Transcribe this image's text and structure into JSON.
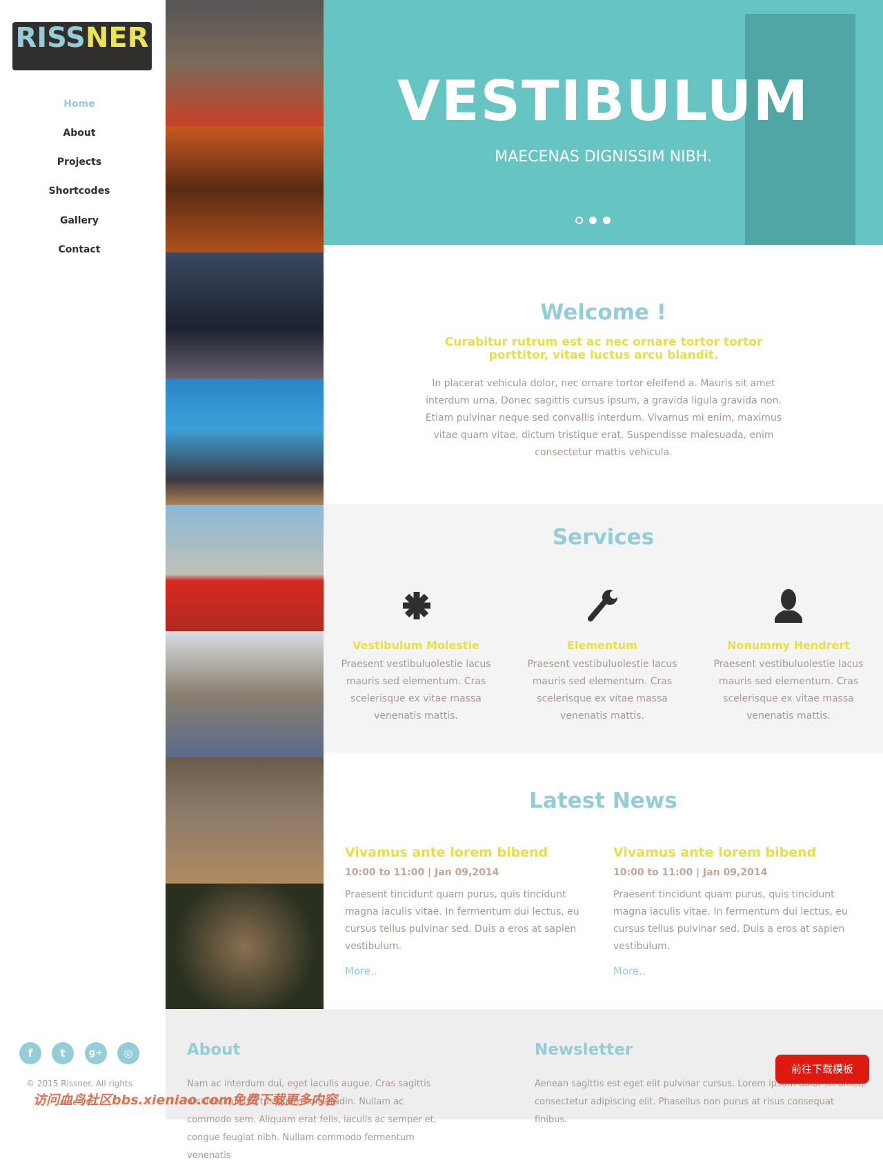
{
  "brand": {
    "part1": "RISS",
    "part2": "NER"
  },
  "nav": [
    {
      "label": "Home",
      "active": true
    },
    {
      "label": "About"
    },
    {
      "label": "Projects"
    },
    {
      "label": "Shortcodes"
    },
    {
      "label": "Gallery"
    },
    {
      "label": "Contact"
    }
  ],
  "hero": {
    "title": "VESTIBULUM",
    "subtitle": "MAECENAS DIGNISSIM NIBH.",
    "slides": 3,
    "active_slide": 1
  },
  "welcome": {
    "title": "Welcome !",
    "subtitle": "Curabitur rutrum est ac nec ornare tortor tortor porttitor, vitae luctus arcu blandit.",
    "text": "In placerat vehicula dolor, nec ornare tortor eleifend a. Mauris sit amet interdum urna. Donec sagittis cursus ipsum, a gravida ligula gravida non. Etiam pulvinar neque sed convallis interdum. Vivamus mi enim, maximus vitae quam vitae, dictum tristique erat. Suspendisse malesuada, enim consectetur mattis vehicula."
  },
  "services": {
    "title": "Services",
    "items": [
      {
        "icon": "asterisk-icon",
        "title": "Vestibulum Molestie",
        "text": "Praesent vestibuluolestie lacus mauris sed elementum. Cras scelerisque ex vitae massa venenatis mattis."
      },
      {
        "icon": "wrench-icon",
        "title": "Elementum",
        "text": "Praesent vestibuluolestie lacus mauris sed elementum. Cras scelerisque ex vitae massa venenatis mattis."
      },
      {
        "icon": "user-icon",
        "title": "Nonummy Hendrert",
        "text": "Praesent vestibuluolestie lacus mauris sed elementum. Cras scelerisque ex vitae massa venenatis mattis."
      }
    ]
  },
  "news": {
    "title": "Latest News",
    "items": [
      {
        "title": "Vivamus ante lorem bibend",
        "meta": "10:00 to 11:00 | Jan 09,2014",
        "text": "Praesent tincidunt quam purus, quis tincidunt magna iaculis vitae. In fermentum dui lectus, eu cursus tellus pulvinar sed. Duis a eros at sapien vestibulum.",
        "more": "More.."
      },
      {
        "title": "Vivamus ante lorem bibend",
        "meta": "10:00 to 11:00 | Jan 09,2014",
        "text": "Praesent tincidunt quam purus, quis tincidunt magna iaculis vitae. In fermentum dui lectus, eu cursus tellus pulvinar sed. Duis a eros at sapien vestibulum.",
        "more": "More.."
      }
    ]
  },
  "footer": {
    "about_title": "About",
    "about_text": "Nam ac interdum dui, eget iaculis augue. Cras sagittis orci leo, quis luctus quam sollicitudin. Nullam ac commodo sem. Aliquam erat felis, iaculis ac semper et, congue feugiat nibh. Nullam commodo fermentum venenatis",
    "newsletter_title": "Newsletter",
    "newsletter_text": "Aenean sagittis est eget elit pulvinar cursus. Lorem ipsum dolor sit amet, consectetur adipiscing elit. Phasellus non purus at risus consequat finibus.",
    "copyright": "© 2015 Rissner. All rights reserved.",
    "social": [
      "f",
      "t",
      "g+",
      "ig"
    ]
  },
  "download_button": "前往下载模板",
  "watermark": "访问血鸟社区bbs.xieniao.com免费下载更多内容",
  "colors": {
    "accent": "#94cdd7",
    "yellow": "#e6df47",
    "dark": "#312f2d",
    "hero": "#66c4c3",
    "button": "#dd1a10"
  }
}
